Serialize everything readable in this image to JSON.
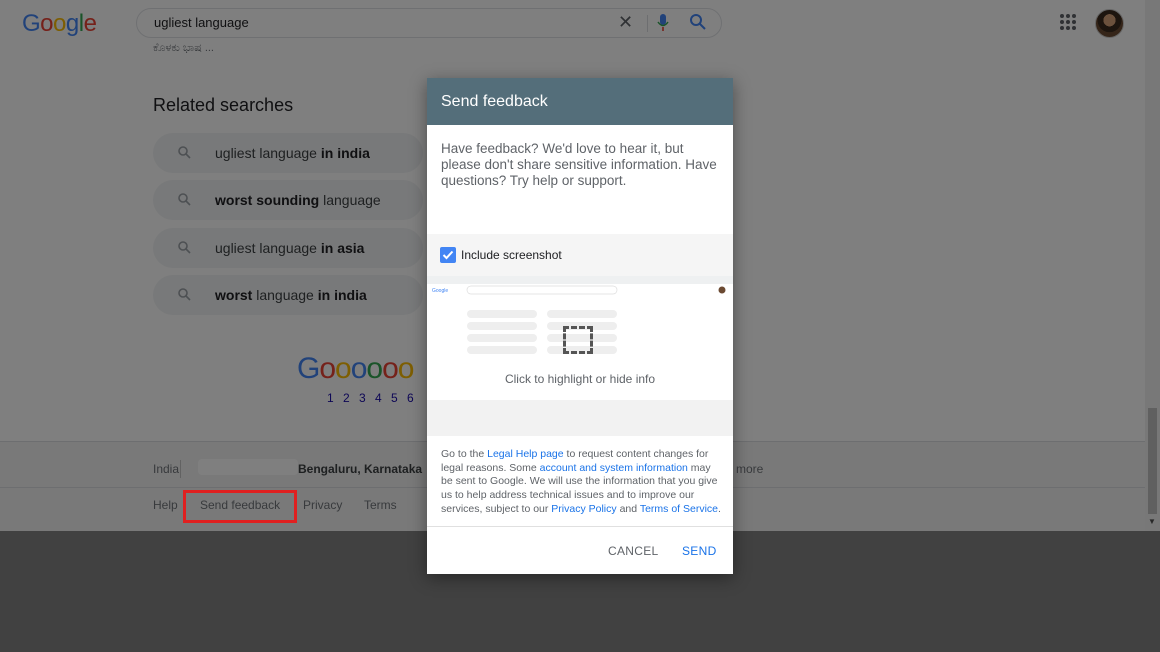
{
  "header": {
    "logo": "Google",
    "search_value": "ugliest language",
    "apps_icon": "apps-grid-icon",
    "avatar_icon": "user-avatar"
  },
  "results": {
    "truncated_snippet": "ಕೊಳಕು ಭಾಷ ..."
  },
  "related": {
    "title": "Related searches",
    "items": [
      {
        "pre": "ugliest language ",
        "bold": "in india",
        "post": ""
      },
      {
        "pre": "",
        "bold": "worst sounding",
        "post": " language"
      },
      {
        "pre": "ugliest language ",
        "bold": "in asia",
        "post": ""
      },
      {
        "pre": "",
        "bold": "worst",
        "post": " language "
      },
      {
        "pre": "",
        "bold": "in india",
        "post": ""
      }
    ]
  },
  "pagination": {
    "logo_text": "Goooooo",
    "pages": "1 2 3 4 5 6"
  },
  "footer": {
    "country": "India",
    "location": "Bengaluru, Karnataka",
    "more": "more",
    "links": [
      "Help",
      "Send feedback",
      "Privacy",
      "Terms"
    ]
  },
  "dialog": {
    "title": "Send feedback",
    "intro": "Have feedback? We'd love to hear it, but please don't share sensitive information. Have questions? Try help or support.",
    "include_screenshot_label": "Include screenshot",
    "include_screenshot_checked": true,
    "highlight_text": "Click to highlight or hide info",
    "legal": {
      "p1": "Go to the ",
      "link1": "Legal Help page",
      "p2": " to request content changes for legal reasons. Some ",
      "link2": "account and system information",
      "p3": " may be sent to Google. We will use the information that you give us to help address technical issues and to improve our services, subject to our ",
      "link3": "Privacy Policy",
      "p4": " and ",
      "link4": "Terms of Service",
      "p5": "."
    },
    "cancel_label": "CANCEL",
    "send_label": "SEND"
  },
  "colors": {
    "dialog_header": "#546e7a",
    "link": "#1a73e8",
    "highlight_box": "#e02020"
  }
}
